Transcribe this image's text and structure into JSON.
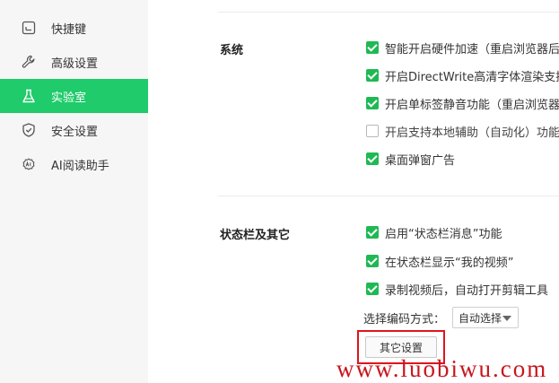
{
  "sidebar": {
    "items": [
      {
        "label": "快捷键",
        "icon": "keyboard-icon",
        "active": false
      },
      {
        "label": "高级设置",
        "icon": "wrench-icon",
        "active": false
      },
      {
        "label": "实验室",
        "icon": "flask-icon",
        "active": true
      },
      {
        "label": "安全设置",
        "icon": "shield-icon",
        "active": false
      },
      {
        "label": "AI阅读助手",
        "icon": "ai-assistant-icon",
        "active": false
      }
    ]
  },
  "system": {
    "title": "系统",
    "options": [
      {
        "label": "智能开启硬件加速（重启浏览器后",
        "checked": true
      },
      {
        "label": "开启DirectWrite高清字体渲染支持",
        "checked": true
      },
      {
        "label": "开启单标签静音功能（重启浏览器",
        "checked": true
      },
      {
        "label": "开启支持本地辅助（自动化）功能",
        "checked": false
      },
      {
        "label": "桌面弹窗广告",
        "checked": true
      }
    ]
  },
  "statusbar": {
    "title": "状态栏及其它",
    "options": [
      {
        "label": "启用“状态栏消息”功能",
        "checked": true
      },
      {
        "label": "在状态栏显示“我的视频”",
        "checked": true
      },
      {
        "label": "录制视频后，自动打开剪辑工具",
        "checked": true
      }
    ],
    "encoding_label": "选择编码方式：",
    "encoding_value": "自动选择",
    "other_button": "其它设置"
  },
  "watermark": "www.luobiwu.com",
  "colors": {
    "accent": "#1fcb6a",
    "checkbox": "#1fb954",
    "highlight": "#e0151d",
    "watermark": "#c8161d"
  }
}
